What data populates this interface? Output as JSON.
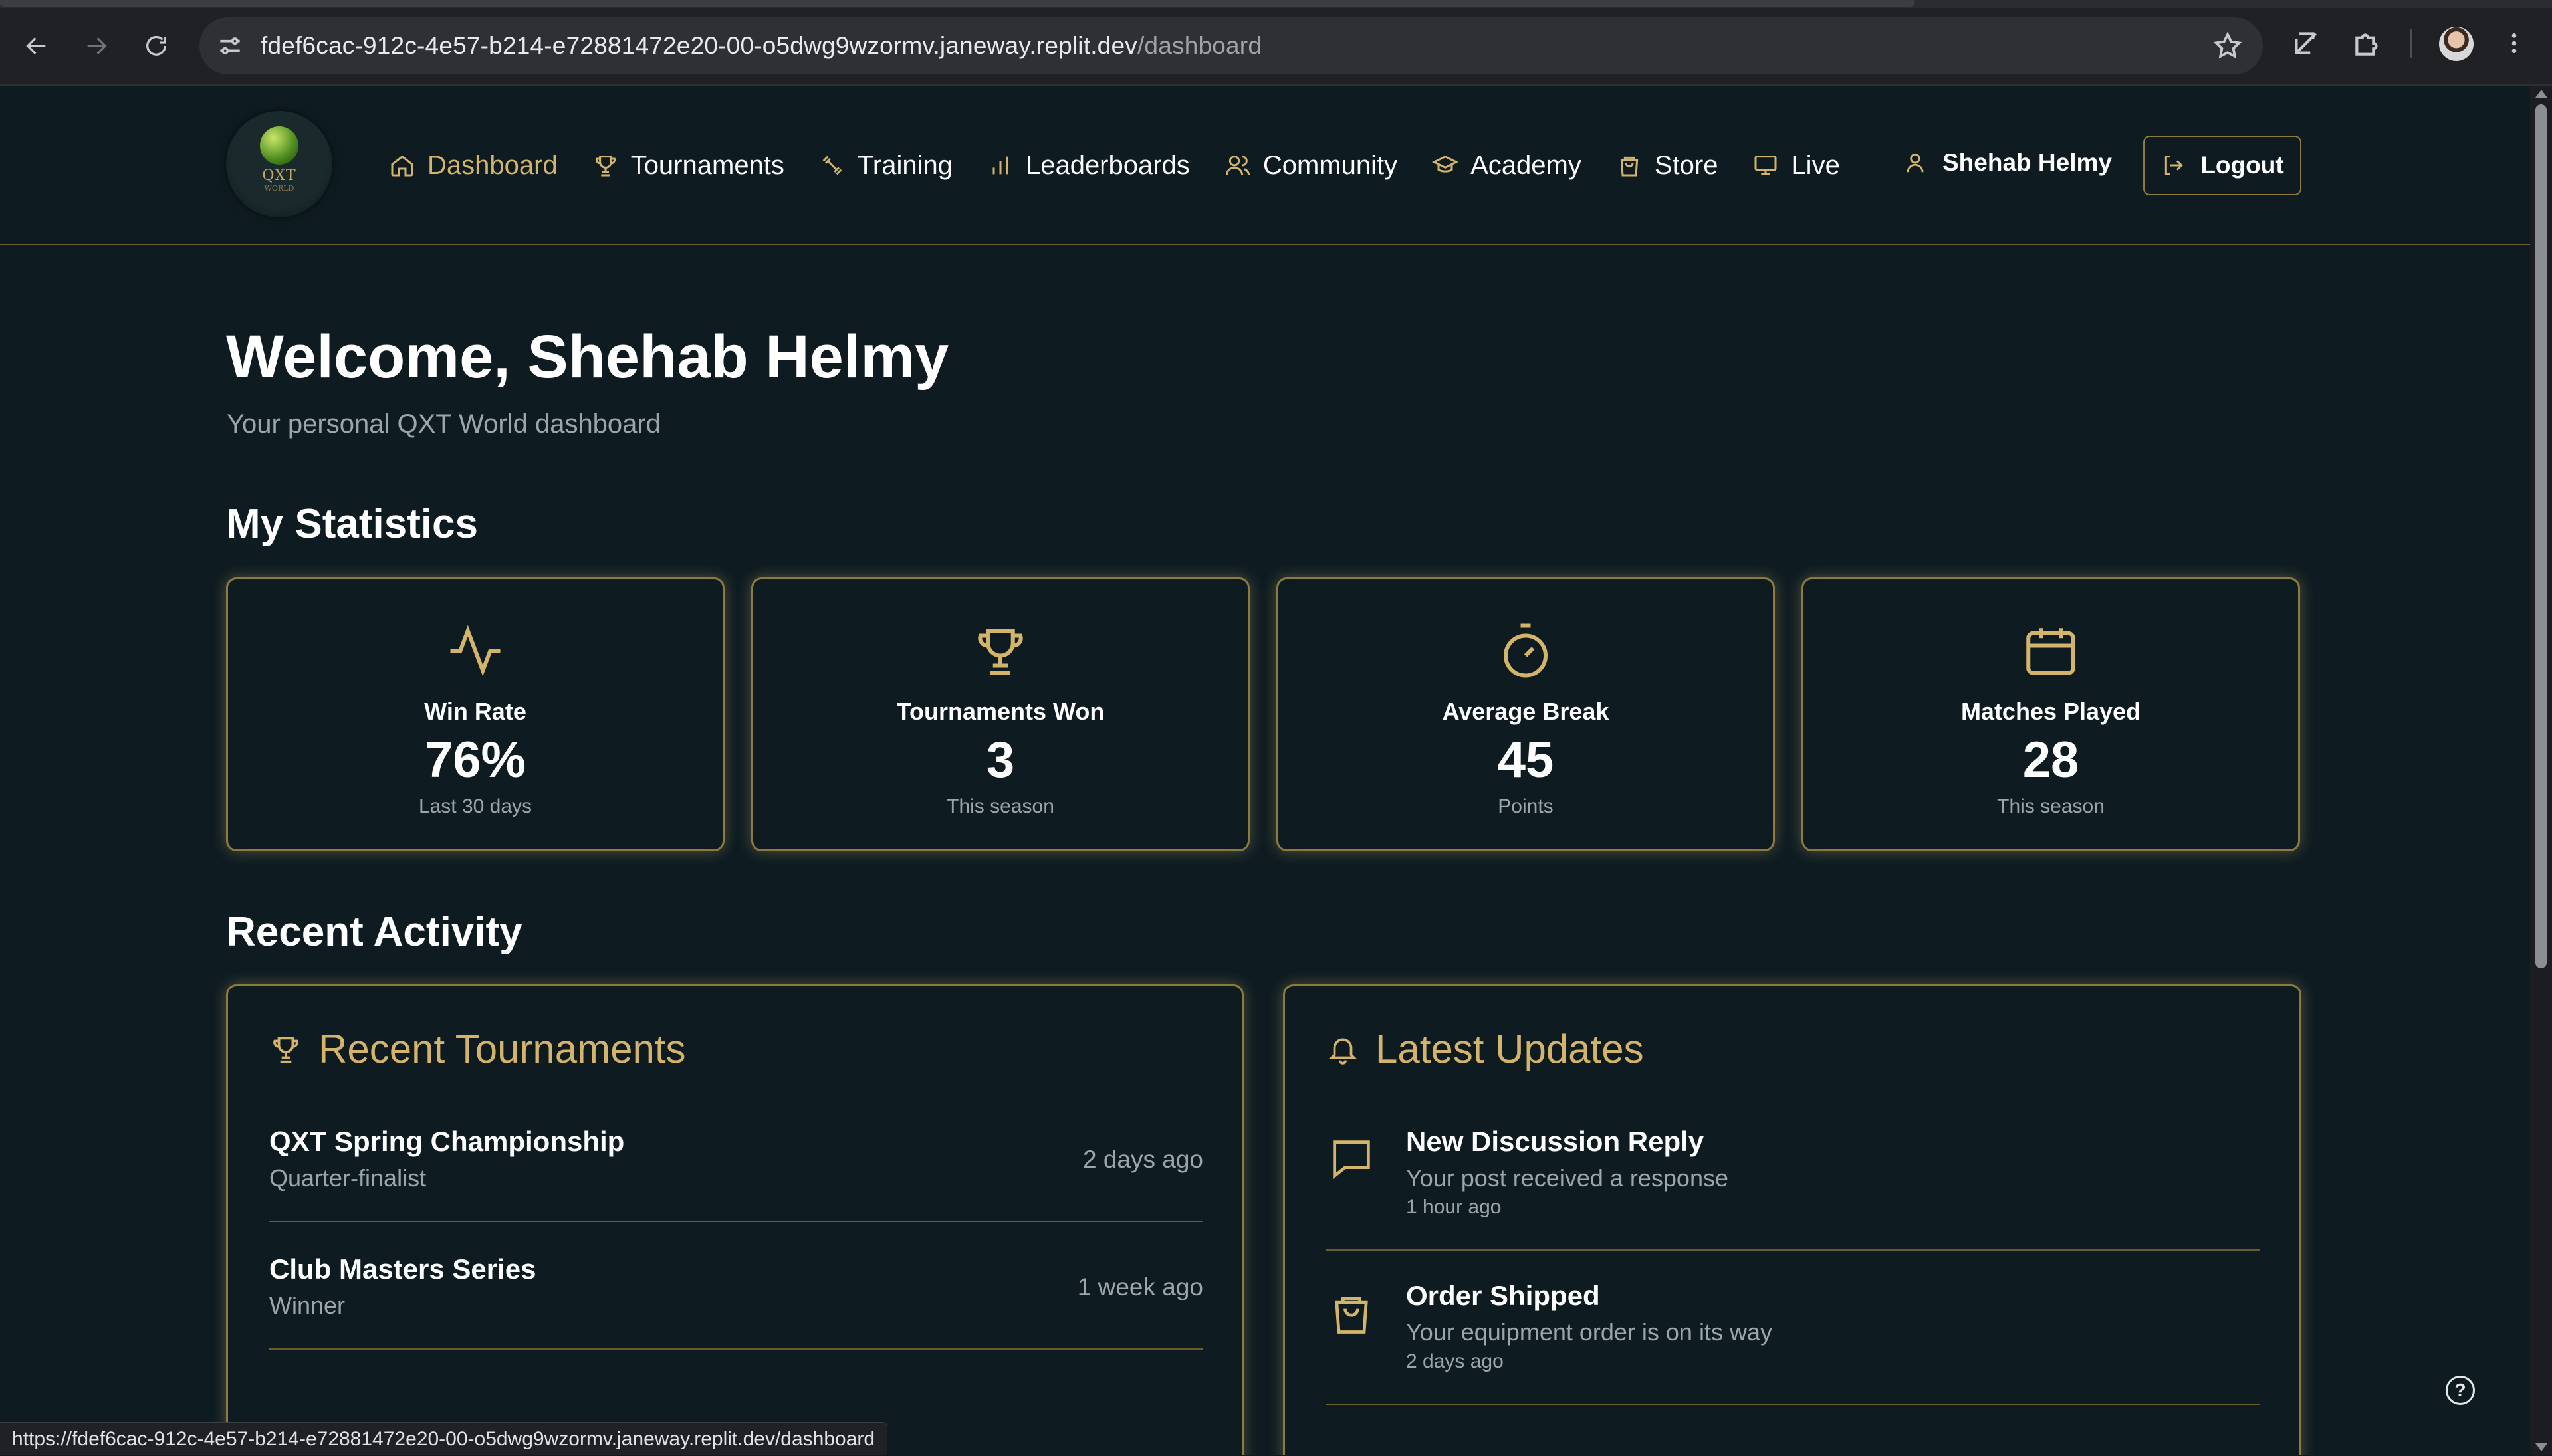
{
  "browser": {
    "url_host": "fdef6cac-912c-4e57-b214-e72881472e20-00-o5dwg9wzormv.janeway.replit.dev",
    "url_path": "/dashboard",
    "status_url": "https://fdef6cac-912c-4e57-b214-e72881472e20-00-o5dwg9wzormv.janeway.replit.dev/dashboard",
    "icons": [
      "back-icon",
      "forward-icon",
      "reload-icon",
      "site-info-icon",
      "bookmark-star-icon",
      "extension-icon",
      "puzzle-icon",
      "profile-avatar",
      "menu-dots-icon"
    ]
  },
  "header": {
    "logo_text": "QXT",
    "logo_sub": "WORLD",
    "nav": [
      {
        "label": "Dashboard",
        "icon": "home-icon",
        "active": true
      },
      {
        "label": "Tournaments",
        "icon": "trophy-icon"
      },
      {
        "label": "Training",
        "icon": "dumbbell-icon"
      },
      {
        "label": "Leaderboards",
        "icon": "bar-chart-icon"
      },
      {
        "label": "Community",
        "icon": "users-icon"
      },
      {
        "label": "Academy",
        "icon": "graduation-cap-icon"
      },
      {
        "label": "Store",
        "icon": "shopping-bag-icon"
      },
      {
        "label": "Live",
        "icon": "monitor-icon"
      }
    ],
    "user_name": "Shehab Helmy",
    "logout_label": "Logout"
  },
  "welcome": {
    "title": "Welcome, Shehab Helmy",
    "subtitle": "Your personal QXT World dashboard"
  },
  "statistics": {
    "title": "My Statistics",
    "cards": [
      {
        "label": "Win Rate",
        "value": "76%",
        "note": "Last 30 days",
        "icon": "activity-icon"
      },
      {
        "label": "Tournaments Won",
        "value": "3",
        "note": "This season",
        "icon": "trophy-icon"
      },
      {
        "label": "Average Break",
        "value": "45",
        "note": "Points",
        "icon": "timer-icon"
      },
      {
        "label": "Matches Played",
        "value": "28",
        "note": "This season",
        "icon": "calendar-icon"
      }
    ]
  },
  "activity": {
    "title": "Recent Activity",
    "tournaments": {
      "title": "Recent Tournaments",
      "items": [
        {
          "name": "QXT Spring Championship",
          "result": "Quarter-finalist",
          "time": "2 days ago"
        },
        {
          "name": "Club Masters Series",
          "result": "Winner",
          "time": "1 week ago"
        }
      ]
    },
    "updates": {
      "title": "Latest Updates",
      "items": [
        {
          "title": "New Discussion Reply",
          "desc": "Your post received a response",
          "time": "1 hour ago",
          "icon": "message-icon"
        },
        {
          "title": "Order Shipped",
          "desc": "Your equipment order is on its way",
          "time": "2 days ago",
          "icon": "shopping-bag-icon"
        }
      ]
    }
  },
  "colors": {
    "background": "#0e1c22",
    "accent_gold": "#d4b46a",
    "border_gold": "#8f7a3d",
    "muted_text": "#9aa6aa"
  }
}
